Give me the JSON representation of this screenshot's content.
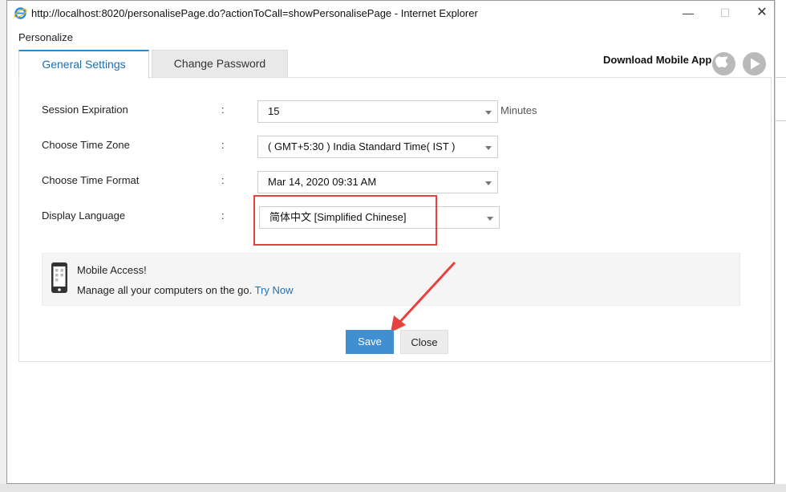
{
  "window": {
    "title": "http://localhost:8020/personalisePage.do?actionToCall=showPersonalisePage - Internet Explorer",
    "minimize_icon": "minimize-icon",
    "maximize_icon": "maximize-icon",
    "close_icon": "close-icon"
  },
  "page": {
    "heading": "Personalize",
    "tabs": [
      {
        "label": "General Settings",
        "active": true
      },
      {
        "label": "Change Password",
        "active": false
      }
    ],
    "download": {
      "label": "Download Mobile App",
      "icons": [
        "apple-icon",
        "google-play-icon"
      ]
    }
  },
  "settings": {
    "colon": ":",
    "rows": [
      {
        "label": "Session Expiration",
        "value": "15",
        "unit": "Minutes"
      },
      {
        "label": "Choose Time Zone",
        "value": "( GMT+5:30 ) India Standard Time( IST )"
      },
      {
        "label": "Choose Time Format",
        "value": "Mar 14, 2020 09:31 AM"
      },
      {
        "label": "Display Language",
        "value": "简体中文 [Simplified Chinese]"
      }
    ]
  },
  "mobile_access": {
    "title": "Mobile Access!",
    "description": "Manage all your computers on the go.",
    "link": "Try Now"
  },
  "buttons": {
    "save": "Save",
    "close": "Close"
  },
  "annotation": {
    "highlight_color": "#e8403d"
  },
  "colors": {
    "accent": "#1b6fb5",
    "save_button": "#3f8fd1"
  }
}
